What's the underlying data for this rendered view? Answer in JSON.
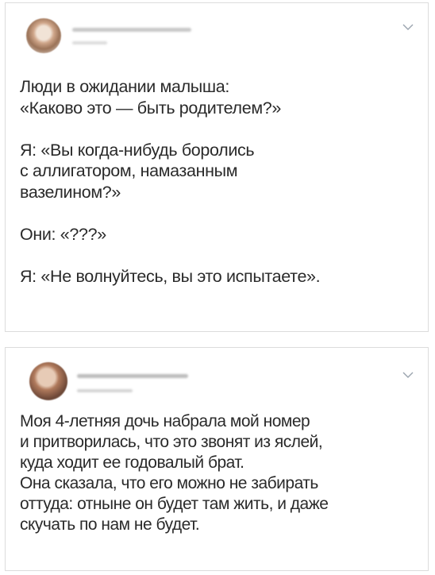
{
  "tweets": [
    {
      "text": "Люди в ожидании малыша:\n«Каково это — быть родителем?»\n\nЯ: «Вы когда-нибудь боролись\nс аллигатором, намазанным\nвазелином?»\n\nОни: «???»\n\nЯ: «Не волнуйтесь, вы это испытаете»."
    },
    {
      "text": "Моя 4-летняя дочь набрала мой номер\nи притворилась, что это звонят из яслей,\nкуда ходит ее годовалый брат.\nОна сказала, что его можно не забирать\nоттуда: отныне он будет там жить, и даже\nскучать по нам не будет."
    }
  ],
  "icons": {
    "avatar": "profile-photo-blurred",
    "menu": "chevron-down-icon"
  },
  "colors": {
    "border": "#dcdcdc",
    "text": "#2a2a2a",
    "redacted": "#c8c8c8"
  }
}
